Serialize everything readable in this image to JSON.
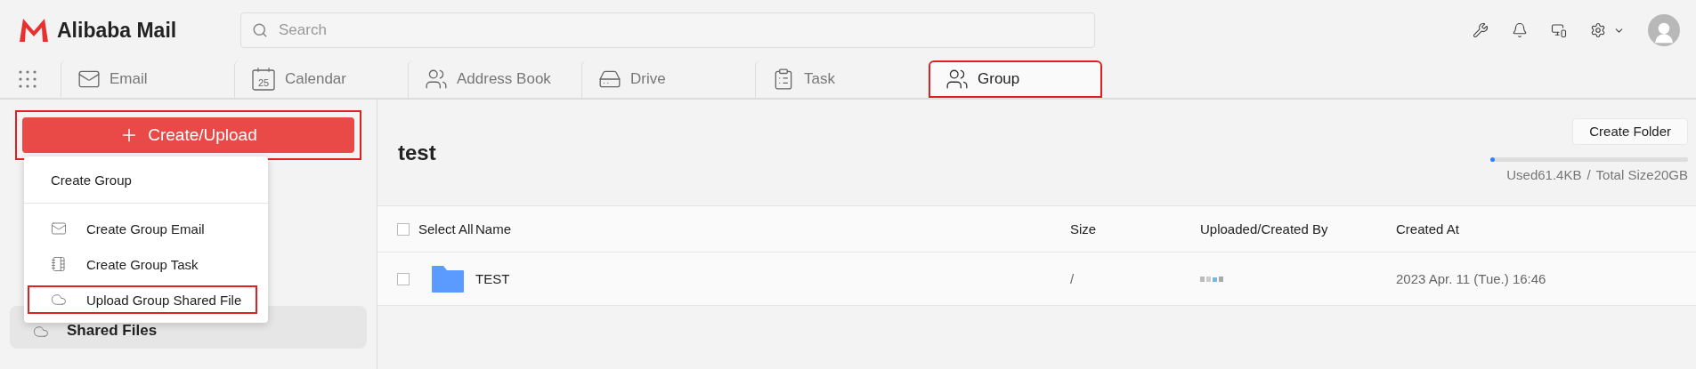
{
  "brand": {
    "name": "Alibaba Mail"
  },
  "search": {
    "placeholder": "Search"
  },
  "nav_tabs": [
    {
      "label": "Email",
      "selected": false,
      "highlighted": false
    },
    {
      "label": "Calendar",
      "icon_text": "25",
      "selected": false,
      "highlighted": false
    },
    {
      "label": "Address Book",
      "selected": false,
      "highlighted": false
    },
    {
      "label": "Drive",
      "selected": false,
      "highlighted": false
    },
    {
      "label": "Task",
      "selected": false,
      "highlighted": false
    },
    {
      "label": "Group",
      "selected": true,
      "highlighted": true
    }
  ],
  "sidebar": {
    "create_button": {
      "label": "Create/Upload",
      "highlighted": true
    },
    "menu": [
      {
        "label": "Create Group",
        "highlighted": false
      },
      {
        "label": "Create Group Email",
        "highlighted": false
      },
      {
        "label": "Create Group Task",
        "highlighted": false
      },
      {
        "label": "Upload Group Shared File",
        "highlighted": true
      }
    ],
    "items": [
      {
        "label": "Shared Files",
        "selected": true
      }
    ]
  },
  "main": {
    "title": "test",
    "create_folder": "Create Folder",
    "storage": {
      "level": 0.01,
      "used": "Used61.4KB",
      "separator": "/",
      "total": "Total Size20GB"
    },
    "table": {
      "select_all": "Select All",
      "select_all_checked": false,
      "columns": [
        "Name",
        "Size",
        "Uploaded/Created By",
        "Created At"
      ],
      "rows": [
        {
          "name": "TEST",
          "kind": "folder",
          "size": "/",
          "created_at": "2023 Apr. 11 (Tue.) 16:46",
          "checked": false
        }
      ]
    }
  }
}
